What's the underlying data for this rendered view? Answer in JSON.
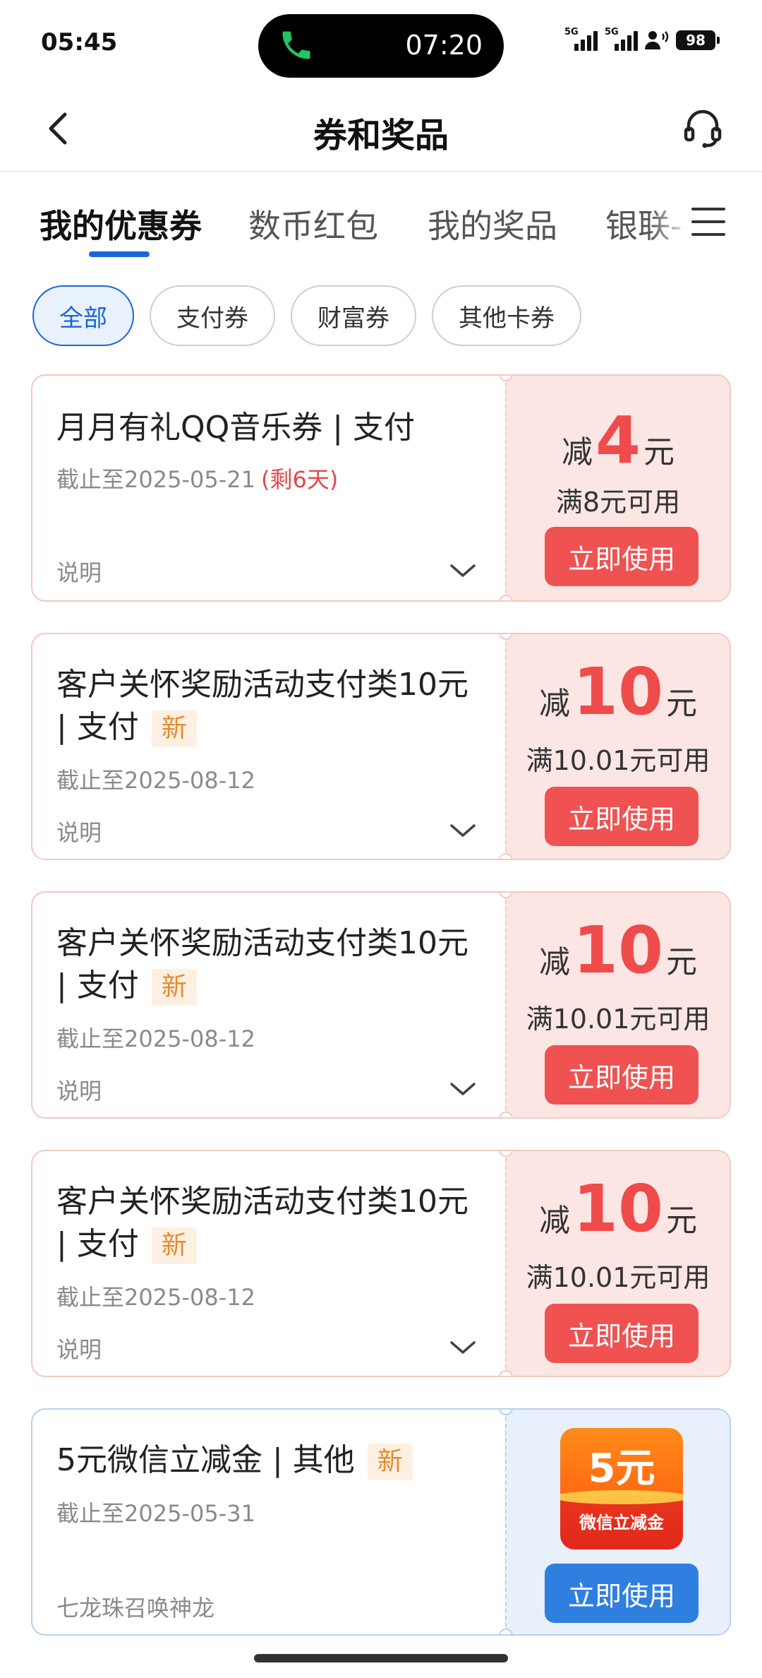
{
  "status_bar": {
    "time": "05:45",
    "call_time": "07:20",
    "signal_labels": [
      "5G",
      "5G"
    ],
    "battery": "98"
  },
  "nav": {
    "title": "券和奖品"
  },
  "tabs": [
    {
      "label": "我的优惠券",
      "active": true
    },
    {
      "label": "数币红包",
      "active": false
    },
    {
      "label": "我的奖品",
      "active": false
    },
    {
      "label": "银联-",
      "active": false
    }
  ],
  "filters": [
    {
      "label": "全部",
      "active": true
    },
    {
      "label": "支付券",
      "active": false
    },
    {
      "label": "财富券",
      "active": false
    },
    {
      "label": "其他卡券",
      "active": false
    }
  ],
  "coupons": [
    {
      "title": "月月有礼QQ音乐券 | 支付",
      "tag": "",
      "date": "截止至2025-05-21",
      "remain": "(剩6天)",
      "note": "说明",
      "prefix": "减",
      "amount": "4",
      "unit": "元",
      "condition": "满8元可用",
      "button": "立即使用"
    },
    {
      "title": "客户关怀奖励活动支付类10元 | 支付",
      "tag": "新",
      "date": "截止至2025-08-12",
      "remain": "",
      "note": "说明",
      "prefix": "减",
      "amount": "10",
      "unit": "元",
      "condition": "满10.01元可用",
      "button": "立即使用"
    },
    {
      "title": "客户关怀奖励活动支付类10元 | 支付",
      "tag": "新",
      "date": "截止至2025-08-12",
      "remain": "",
      "note": "说明",
      "prefix": "减",
      "amount": "10",
      "unit": "元",
      "condition": "满10.01元可用",
      "button": "立即使用"
    },
    {
      "title": "客户关怀奖励活动支付类10元 | 支付",
      "tag": "新",
      "date": "截止至2025-08-12",
      "remain": "",
      "note": "说明",
      "prefix": "减",
      "amount": "10",
      "unit": "元",
      "condition": "满10.01元可用",
      "button": "立即使用"
    },
    {
      "title": "5元微信立减金 | 其他",
      "tag": "新",
      "date": "截止至2025-05-31",
      "remain": "",
      "note": "七龙珠召唤神龙",
      "badge_big": "5元",
      "badge_small": "微信立减金",
      "button": "立即使用"
    }
  ],
  "colors": {
    "accent_blue": "#1a66d9",
    "coupon_red": "#f05252",
    "new_tag": "#e88a2c"
  }
}
